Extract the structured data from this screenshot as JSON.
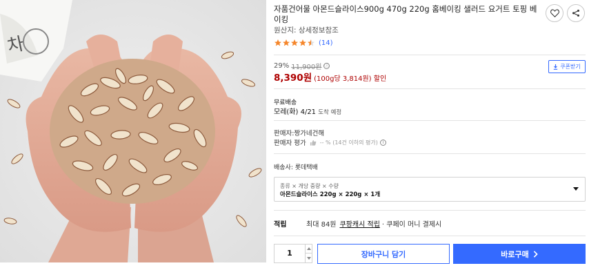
{
  "product": {
    "title": "자품건어물 아몬드슬라이스900g 470g 220g 홈베이킹 샐러드 요거트 토핑 베이킹",
    "origin": "원산지: 상세정보참조",
    "rating": {
      "stars": 4.5,
      "count": "(14)"
    }
  },
  "price": {
    "discount_rate": "29%",
    "original": "11,900원",
    "info_icon": "ⓘ",
    "sale": "8,390원",
    "unit": "(100g당 3,814원) 할인"
  },
  "coupon": {
    "label": "쿠폰받기"
  },
  "shipping": {
    "title": "무료배송",
    "date": "모레(화) 4/21",
    "date_note": "도착 예정"
  },
  "seller": {
    "name": "판매자:짱가네건해",
    "rating_label": "판매자 평가",
    "rating_note": "-- % (14건 이하의 평가)"
  },
  "carrier": "배송사: 롯데택배",
  "option": {
    "label": "종류 × 개당 중량 × 수량",
    "value": "아몬드슬라이스 220g × 220g × 1개"
  },
  "cash": {
    "label": "적립",
    "prefix": "최대 84원",
    "link": "쿠팡캐시 적립",
    "suffix": "· 쿠페이 머니 결제시"
  },
  "quantity": "1",
  "buttons": {
    "cart": "장바구니 담기",
    "buy": "바로구매"
  },
  "colors": {
    "accent": "#346aff",
    "price": "#ae0000",
    "star": "#f5862b"
  },
  "icons": {
    "wishlist": "heart-icon",
    "share": "share-icon",
    "coupon": "download-icon",
    "buy": "chevron-right-icon"
  }
}
